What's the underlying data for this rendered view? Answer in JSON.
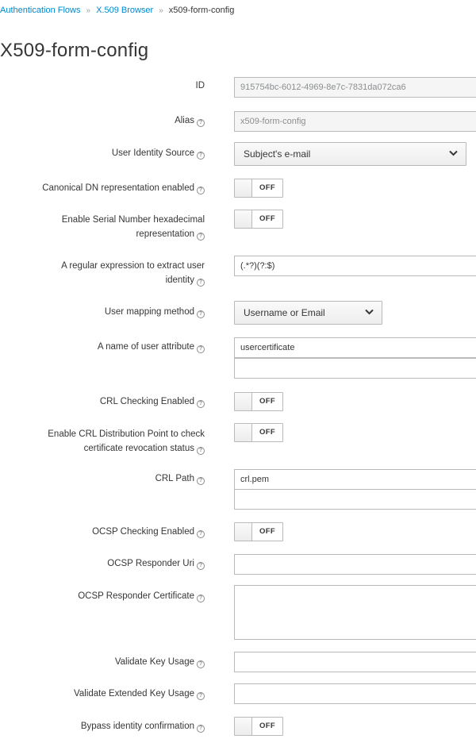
{
  "breadcrumb": {
    "items": [
      "Authentication Flows",
      "X.509 Browser",
      "x509-form-config"
    ],
    "separator": "»"
  },
  "page_title": "X509-form-config",
  "help_glyph": "?",
  "fields": {
    "id": {
      "label": "ID",
      "value": "915754bc-6012-4969-8e7c-7831da072ca6"
    },
    "alias": {
      "label": "Alias",
      "value": "x509-form-config"
    },
    "user_identity_source": {
      "label": "User Identity Source",
      "value": "Subject's e-mail"
    },
    "canonical_dn": {
      "label": "Canonical DN representation enabled",
      "state": "OFF"
    },
    "serial_hex": {
      "label_line1": "Enable Serial Number hexadecimal",
      "label_line2": "representation",
      "state": "OFF"
    },
    "regex": {
      "label_line1": "A regular expression to extract user",
      "label_line2": "identity",
      "value": "(.*?)(?:$)"
    },
    "user_mapping_method": {
      "label": "User mapping method",
      "value": "Username or Email"
    },
    "user_attribute": {
      "label": "A name of user attribute",
      "value": "usercertificate",
      "value2": ""
    },
    "crl_checking": {
      "label": "CRL Checking Enabled",
      "state": "OFF"
    },
    "crl_distribution": {
      "label_line1": "Enable CRL Distribution Point to check",
      "label_line2": "certificate revocation status",
      "state": "OFF"
    },
    "crl_path": {
      "label": "CRL Path",
      "value": "crl.pem",
      "value2": ""
    },
    "ocsp_checking": {
      "label": "OCSP Checking Enabled",
      "state": "OFF"
    },
    "ocsp_uri": {
      "label": "OCSP Responder Uri",
      "value": ""
    },
    "ocsp_cert": {
      "label": "OCSP Responder Certificate",
      "value": ""
    },
    "key_usage": {
      "label": "Validate Key Usage",
      "value": ""
    },
    "ext_key_usage": {
      "label": "Validate Extended Key Usage",
      "value": ""
    },
    "bypass_confirmation": {
      "label": "Bypass identity confirmation",
      "state": "OFF"
    }
  }
}
